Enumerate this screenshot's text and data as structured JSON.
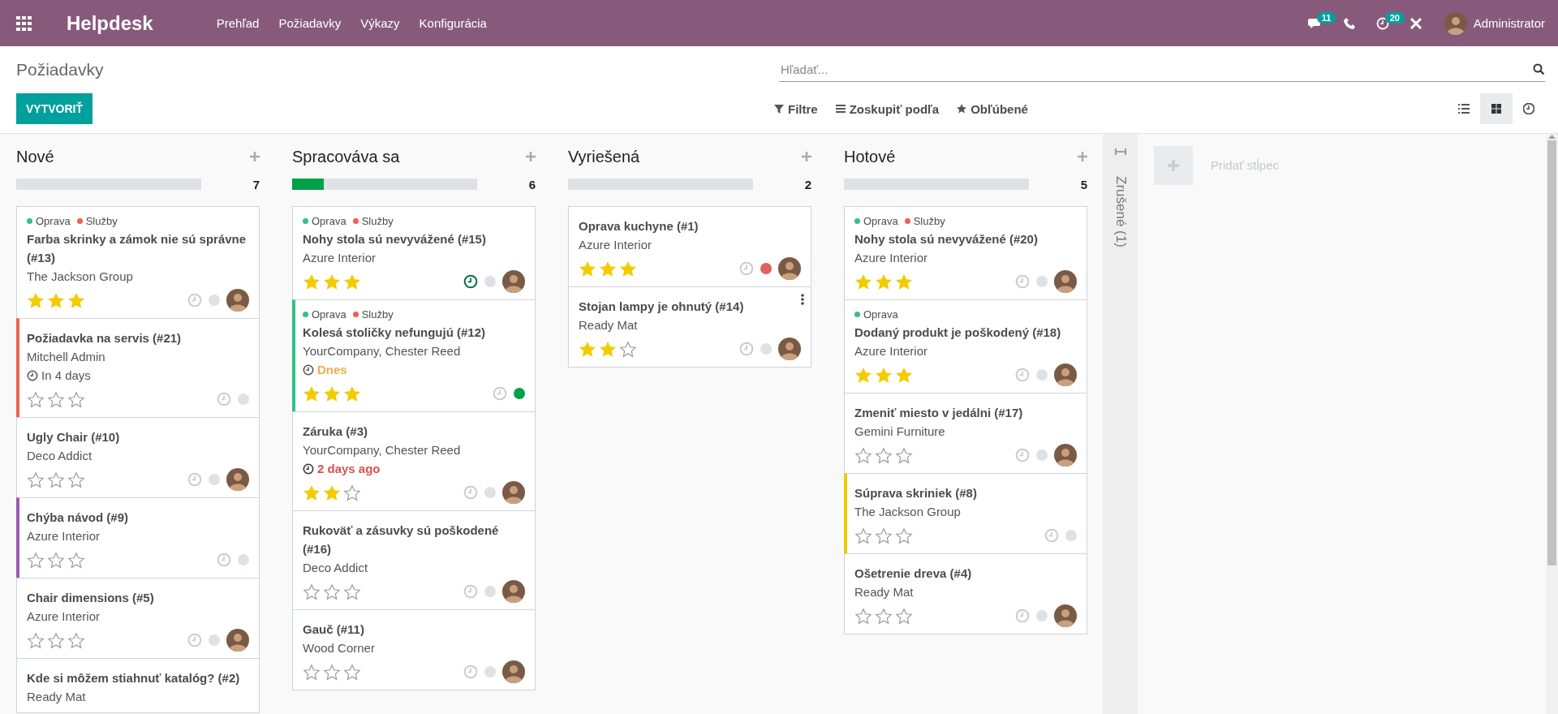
{
  "navbar": {
    "app_name": "Helpdesk",
    "menu": [
      "Prehľad",
      "Požiadavky",
      "Výkazy",
      "Konfigurácia"
    ],
    "messages_count": "11",
    "activities_count": "20",
    "user": "Administrator"
  },
  "control_panel": {
    "breadcrumb": "Požiadavky",
    "search": {
      "placeholder": "Hľadať..."
    },
    "create_button": "VYTVORIŤ",
    "filters": [
      {
        "kind": "filter",
        "label": "Filtre"
      },
      {
        "kind": "group",
        "label": "Zoskupiť podľa"
      },
      {
        "kind": "favorite",
        "label": "Obľúbené"
      }
    ],
    "views": [
      {
        "kind": "list",
        "selected": false
      },
      {
        "kind": "kanban",
        "selected": true
      },
      {
        "kind": "activity",
        "selected": false
      }
    ]
  },
  "columns": [
    {
      "title": "Nové",
      "count": "7",
      "level": 0,
      "cards": [
        {
          "tags": [
            {
              "label": "Oprava",
              "color": "#30c381"
            },
            {
              "label": "Služby",
              "color": "#f06050"
            }
          ],
          "title": "Farba skrinky a zámok nie sú správne (#13)",
          "customer": "The Jackson Group",
          "stars": 3,
          "activity_planned": false,
          "blocked": false,
          "done": false,
          "assigned": true
        },
        {
          "color": "#f06050",
          "title": "Požiadavka na servis (#21)",
          "customer": "Mitchell Admin",
          "deadline": {
            "text": "In 4 days",
            "kind": "future"
          },
          "stars": 0,
          "activity_planned": false,
          "blocked": false,
          "done": false,
          "assigned": false
        },
        {
          "title": "Ugly Chair (#10)",
          "customer": "Deco Addict",
          "stars": 0,
          "activity_planned": false,
          "blocked": false,
          "done": false,
          "assigned": true
        },
        {
          "color": "#9b59b6",
          "title": "Chýba návod (#9)",
          "customer": "Azure Interior",
          "stars": 0,
          "activity_planned": false,
          "blocked": false,
          "done": false,
          "assigned": false
        },
        {
          "title": "Chair dimensions (#5)",
          "customer": "Azure Interior",
          "stars": 0,
          "activity_planned": false,
          "blocked": false,
          "done": false,
          "assigned": true
        },
        {
          "title": "Kde si môžem stiahnuť katalóg? (#2)",
          "customer": "Ready Mat"
        }
      ]
    },
    {
      "title": "Spracováva sa",
      "count": "6",
      "level": 0.17,
      "cards": [
        {
          "tags": [
            {
              "label": "Oprava",
              "color": "#30c381"
            },
            {
              "label": "Služby",
              "color": "#f06050"
            }
          ],
          "title": "Nohy stola sú nevyvážené (#15)",
          "customer": "Azure Interior",
          "stars": 3,
          "activity_planned": true,
          "blocked": false,
          "done": false,
          "assigned": true
        },
        {
          "color": "#30c381",
          "tags": [
            {
              "label": "Oprava",
              "color": "#30c381"
            },
            {
              "label": "Služby",
              "color": "#f06050"
            }
          ],
          "title": "Kolesá stoličky nefungujú (#12)",
          "customer": "YourCompany, Chester Reed",
          "deadline": {
            "text": "Dnes",
            "kind": "today"
          },
          "stars": 3,
          "activity_planned": false,
          "blocked": false,
          "done": true,
          "assigned": false
        },
        {
          "title": "Záruka (#3)",
          "customer": "YourCompany, Chester Reed",
          "deadline": {
            "text": "2 days ago",
            "kind": "overdue"
          },
          "stars": 2,
          "activity_planned": false,
          "blocked": false,
          "done": false,
          "assigned": true
        },
        {
          "title": "Rukoväť a zásuvky sú poškodené (#16)",
          "customer": "Deco Addict",
          "stars": 0,
          "activity_planned": false,
          "blocked": false,
          "done": false,
          "assigned": true
        },
        {
          "title": "Gauč (#11)",
          "customer": "Wood Corner",
          "stars": 0,
          "activity_planned": false,
          "blocked": false,
          "done": false,
          "assigned": true
        }
      ]
    },
    {
      "title": "Vyriešená",
      "count": "2",
      "level": 0,
      "cards": [
        {
          "title": "Oprava kuchyne (#1)",
          "customer": "Azure Interior",
          "stars": 3,
          "activity_planned": false,
          "blocked": true,
          "done": false,
          "assigned": true
        },
        {
          "title": "Stojan lampy je ohnutý (#14)",
          "customer": "Ready Mat",
          "stars": 2,
          "activity_planned": false,
          "blocked": false,
          "done": false,
          "assigned": true,
          "menu_shown": true
        }
      ]
    },
    {
      "title": "Hotové",
      "count": "5",
      "level": 0,
      "cards": [
        {
          "tags": [
            {
              "label": "Oprava",
              "color": "#30c381"
            },
            {
              "label": "Služby",
              "color": "#f06050"
            }
          ],
          "title": "Nohy stola sú nevyvážené (#20)",
          "customer": "Azure Interior",
          "stars": 3,
          "activity_planned": false,
          "blocked": false,
          "done": false,
          "assigned": true
        },
        {
          "tags": [
            {
              "label": "Oprava",
              "color": "#30c381"
            }
          ],
          "title": "Dodaný produkt je poškodený (#18)",
          "customer": "Azure Interior",
          "stars": 3,
          "activity_planned": false,
          "blocked": false,
          "done": false,
          "assigned": true
        },
        {
          "title": "Zmeniť miesto v jedálni (#17)",
          "customer": "Gemini Furniture",
          "stars": 0,
          "activity_planned": false,
          "blocked": false,
          "done": false,
          "assigned": true
        },
        {
          "color": "#f4c609",
          "title": "Súprava skriniek (#8)",
          "customer": "The Jackson Group",
          "stars": 0,
          "activity_planned": false,
          "blocked": false,
          "done": false,
          "assigned": false
        },
        {
          "title": "Ošetrenie dreva (#4)",
          "customer": "Ready Mat",
          "stars": 0,
          "activity_planned": false,
          "blocked": false,
          "done": false,
          "assigned": true
        }
      ]
    }
  ],
  "folded_column": {
    "title": "Zrušené (1)"
  },
  "add_column": "Pridať stĺpec"
}
